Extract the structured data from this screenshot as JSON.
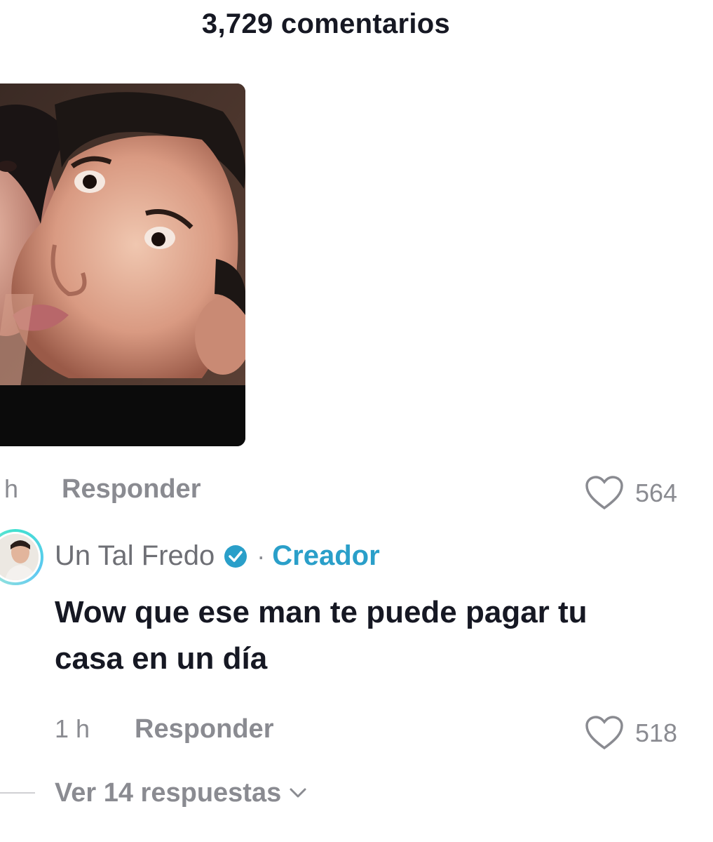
{
  "header": {
    "comment_count_label": "3,729 comentarios"
  },
  "comment1": {
    "time": "h",
    "reply_label": "Responder",
    "likes": "564",
    "attachment": "photo"
  },
  "comment2": {
    "author": "Un Tal Fredo",
    "verified_icon": "verified-badge-icon",
    "separator": "·",
    "badge_label": "Creador",
    "text_line1": "Wow que ese man te puede pagar tu",
    "text_line2": "casa en un día",
    "time": "1 h",
    "reply_label": "Responder",
    "likes": "518"
  },
  "replies": {
    "label": "Ver 14 respuestas",
    "icon": "chevron-down-icon"
  },
  "colors": {
    "text_primary": "#161823",
    "text_secondary": "#8a8b91",
    "creator_accent": "#2a9fc9",
    "avatar_ring": "#40e0d0"
  }
}
